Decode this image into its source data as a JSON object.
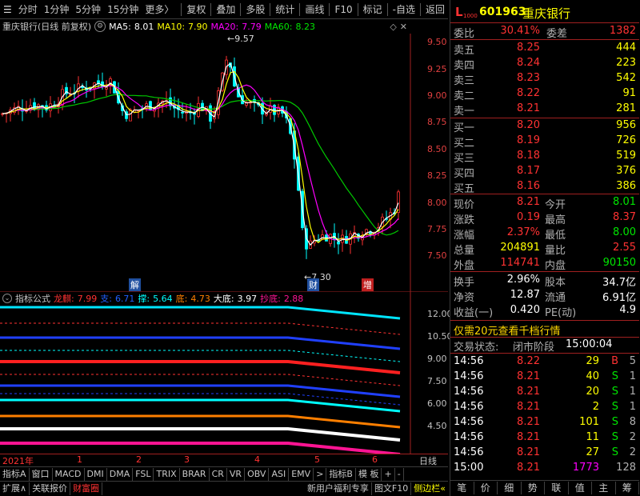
{
  "toolbar": {
    "left_items": [
      "分时",
      "1分钟",
      "5分钟",
      "15分钟",
      "更多〉"
    ],
    "right_items": [
      "复权",
      "叠加",
      "多股",
      "统计",
      "画线",
      "F10",
      "标记",
      "-自选",
      "返回"
    ]
  },
  "chart_header": {
    "stock_name": "重庆银行(日线 前复权)",
    "ma5_label": "MA5:",
    "ma5_value": "8.01",
    "ma10_label": "MA10:",
    "ma10_value": "7.90",
    "ma20_label": "MA20:",
    "ma20_value": "7.79",
    "ma60_label": "MA60:",
    "ma60_value": "8.23",
    "colors": {
      "ma5": "#ffffff",
      "ma10": "#ffff00",
      "ma20": "#ff00ff",
      "ma60": "#00e600"
    }
  },
  "price_axis": [
    "9.50",
    "9.25",
    "9.00",
    "8.75",
    "8.50",
    "8.25",
    "8.00",
    "7.75",
    "7.50"
  ],
  "annotations": {
    "high": "9.57",
    "low": "7.30",
    "jie": "解",
    "cai": "财",
    "zeng": "增"
  },
  "indicator_header": {
    "label": "指标公式",
    "items": [
      {
        "name": "龙麒:",
        "value": "7.99",
        "color": "#ff3232"
      },
      {
        "name": "支:",
        "value": "6.71",
        "color": "#2060ff"
      },
      {
        "name": "撑:",
        "value": "5.64",
        "color": "#00ffff"
      },
      {
        "name": "底:",
        "value": "4.73",
        "color": "#ff8000"
      },
      {
        "name": "大底:",
        "value": "3.97",
        "color": "#ffffff"
      },
      {
        "name": "抄底:",
        "value": "2.88",
        "color": "#ff1493"
      }
    ]
  },
  "indicator_axis": [
    "12.00",
    "10.50",
    "9.00",
    "7.50",
    "6.00",
    "4.50"
  ],
  "time_axis": {
    "year": "2021年",
    "months": [
      "1",
      "2",
      "3",
      "4",
      "5",
      "6"
    ],
    "period": "日线"
  },
  "tabs": [
    "指标A",
    "窗口",
    "MACD",
    "DMI",
    "DMA",
    "FSL",
    "TRIX",
    "BRAR",
    "CR",
    "VR",
    "OBV",
    "ASI",
    "EMV",
    ">",
    "指标B",
    "模 板",
    "+",
    "-"
  ],
  "bottom_bar": {
    "expand": "扩展∧",
    "related": "关联报价",
    "wealth": "财富圈",
    "promo": "新用户福利专享",
    "f10": "图文F10",
    "sidebar": "侧边栏«"
  },
  "quote": {
    "code": "601963",
    "name": "重庆银行",
    "weibi_label": "委比",
    "weibi": "30.41%",
    "weicha_label": "委差",
    "weicha": "1382",
    "asks": [
      {
        "label": "卖五",
        "price": "8.25",
        "vol": "444"
      },
      {
        "label": "卖四",
        "price": "8.24",
        "vol": "223"
      },
      {
        "label": "卖三",
        "price": "8.23",
        "vol": "542"
      },
      {
        "label": "卖二",
        "price": "8.22",
        "vol": "91"
      },
      {
        "label": "卖一",
        "price": "8.21",
        "vol": "281"
      }
    ],
    "bids": [
      {
        "label": "买一",
        "price": "8.20",
        "vol": "956"
      },
      {
        "label": "买二",
        "price": "8.19",
        "vol": "726"
      },
      {
        "label": "买三",
        "price": "8.18",
        "vol": "519"
      },
      {
        "label": "买四",
        "price": "8.17",
        "vol": "376"
      },
      {
        "label": "买五",
        "price": "8.16",
        "vol": "386"
      }
    ],
    "stats": [
      {
        "l1": "现价",
        "v1": "8.21",
        "c1": "#ff3232",
        "l2": "今开",
        "v2": "8.01",
        "c2": "#00e600"
      },
      {
        "l1": "涨跌",
        "v1": "0.19",
        "c1": "#ff3232",
        "l2": "最高",
        "v2": "8.37",
        "c2": "#ff3232"
      },
      {
        "l1": "涨幅",
        "v1": "2.37%",
        "c1": "#ff3232",
        "l2": "最低",
        "v2": "8.00",
        "c2": "#00e600"
      },
      {
        "l1": "总量",
        "v1": "204891",
        "c1": "#ffff00",
        "l2": "量比",
        "v2": "2.55",
        "c2": "#ff3232"
      },
      {
        "l1": "外盘",
        "v1": "114741",
        "c1": "#ff3232",
        "l2": "内盘",
        "v2": "90150",
        "c2": "#00e600"
      }
    ],
    "stats2": [
      {
        "l1": "换手",
        "v1": "2.96%",
        "l2": "股本",
        "v2": "34.7亿"
      },
      {
        "l1": "净资",
        "v1": "12.87",
        "l2": "流通",
        "v2": "6.91亿"
      },
      {
        "l1": "收益(一)",
        "v1": "0.420",
        "l2": "PE(动)",
        "v2": "4.9"
      }
    ],
    "promo": "仅需20元查看千档行情",
    "status_label": "交易状态:",
    "status": "闭市阶段",
    "status_time": "15:00:04",
    "ticks": [
      {
        "time": "14:56",
        "price": "8.22",
        "vol": "29",
        "side": "B",
        "n": "5"
      },
      {
        "time": "14:56",
        "price": "8.21",
        "vol": "40",
        "side": "S",
        "n": "1"
      },
      {
        "time": "14:56",
        "price": "8.21",
        "vol": "20",
        "side": "S",
        "n": "1"
      },
      {
        "time": "14:56",
        "price": "8.21",
        "vol": "2",
        "side": "S",
        "n": "1"
      },
      {
        "time": "14:56",
        "price": "8.21",
        "vol": "101",
        "side": "S",
        "n": "8"
      },
      {
        "time": "14:56",
        "price": "8.21",
        "vol": "11",
        "side": "S",
        "n": "2"
      },
      {
        "time": "14:56",
        "price": "8.21",
        "vol": "27",
        "side": "S",
        "n": "2"
      },
      {
        "time": "15:00",
        "price": "8.21",
        "vol": "1773",
        "side": "",
        "n": "128"
      }
    ],
    "bottom_tabs": [
      "笔",
      "价",
      "细",
      "势",
      "联",
      "值",
      "主",
      "筹"
    ]
  }
}
